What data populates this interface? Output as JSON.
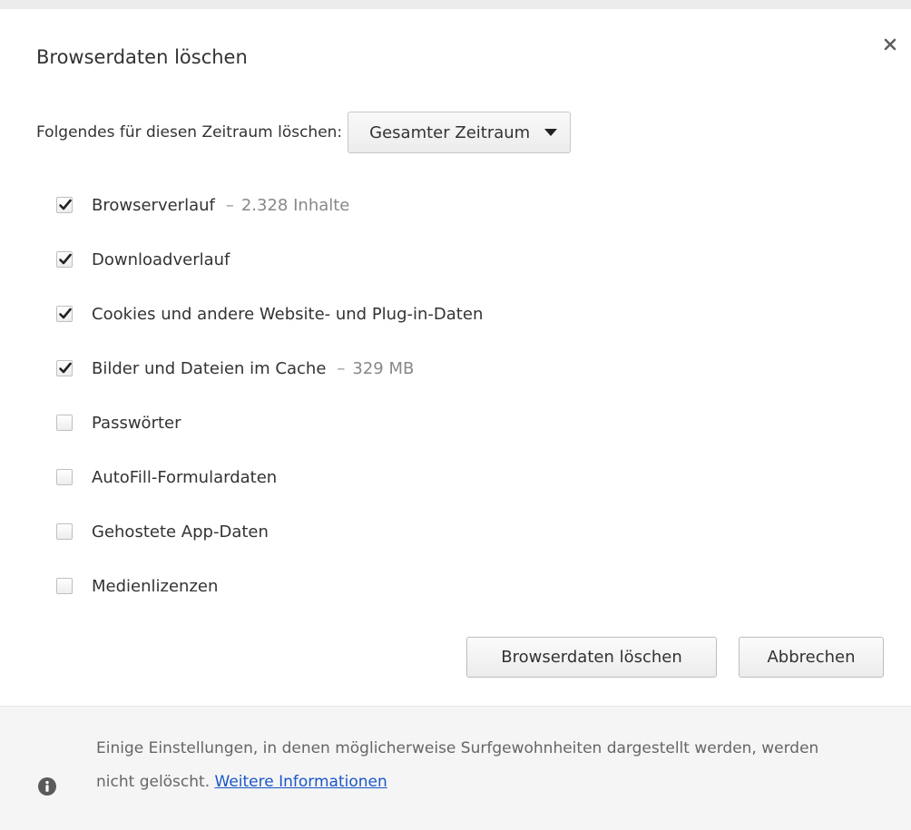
{
  "dialog": {
    "title": "Browserdaten löschen",
    "close_icon": "close-icon"
  },
  "period": {
    "label": "Folgendes für diesen Zeitraum löschen:",
    "selected": "Gesamter Zeitraum"
  },
  "options": [
    {
      "label": "Browserverlauf",
      "separator": "–",
      "meta": "2.328 Inhalte",
      "checked": true
    },
    {
      "label": "Downloadverlauf",
      "checked": true
    },
    {
      "label": "Cookies und andere Website- und Plug-in-Daten",
      "checked": true
    },
    {
      "label": "Bilder und Dateien im Cache",
      "separator": "–",
      "meta": "329 MB",
      "checked": true
    },
    {
      "label": "Passwörter",
      "checked": false
    },
    {
      "label": "AutoFill-Formulardaten",
      "checked": false
    },
    {
      "label": "Gehostete App-Daten",
      "checked": false
    },
    {
      "label": "Medienlizenzen",
      "checked": false
    }
  ],
  "buttons": {
    "clear": "Browserdaten löschen",
    "cancel": "Abbrechen"
  },
  "footer": {
    "text": "Einige Einstellungen, in denen möglicherweise Surfgewohnheiten dargestellt werden, werden nicht gelöscht.",
    "link": "Weitere Informationen",
    "icon": "info-icon"
  },
  "colors": {
    "link": "#1a56c6",
    "footer_bg": "#f5f5f5"
  }
}
